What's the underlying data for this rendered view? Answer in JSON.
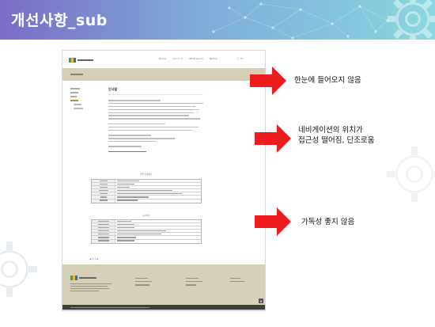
{
  "slide": {
    "title": "개선사항_sub"
  },
  "mockup": {
    "nav": [
      "Home",
      "About us",
      "What we do",
      "Notice"
    ],
    "nav_active_index": 1,
    "content_title": "인사말",
    "table1_title": "연혁 상세정보",
    "table2_title": "공시자료",
    "pager": "◀ 1 / 1 ▶"
  },
  "annotations": [
    {
      "text": "한눈에 들어오지 않음"
    },
    {
      "text": "네비게이션의 위치가\n접근성 떨어짐, 단조로움"
    },
    {
      "text": "가독성 좋지 않음"
    }
  ],
  "colors": {
    "header_start": "#7b6cc6",
    "header_end": "#8bd6e0",
    "arrow": "#ee1c1c",
    "mockup_band": "#d7d0b8",
    "mockup_footer_bottom": "#3f3f3f"
  }
}
